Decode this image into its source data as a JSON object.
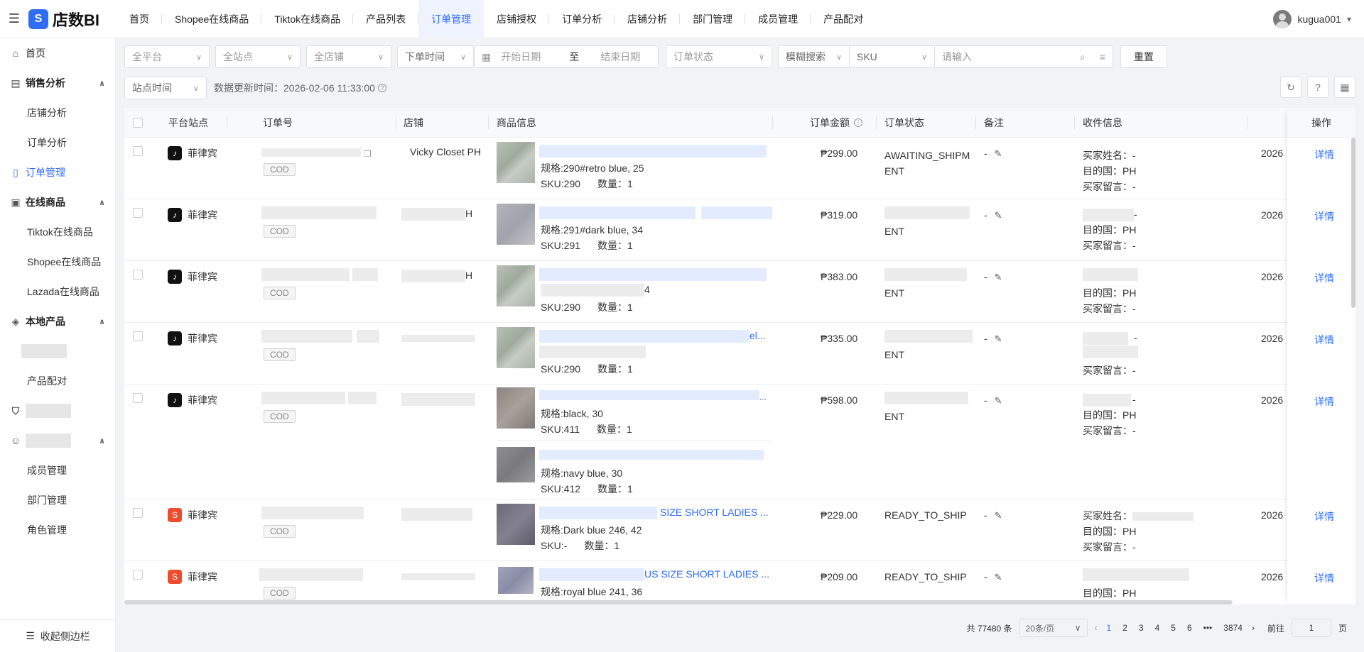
{
  "brand": {
    "name": "店数BI",
    "badge": "S"
  },
  "topnav": [
    "首页",
    "Shopee在线商品",
    "Tiktok在线商品",
    "产品列表",
    "订单管理",
    "店铺授权",
    "订单分析",
    "店铺分析",
    "部门管理",
    "成员管理",
    "产品配对"
  ],
  "topnav_active": "订单管理",
  "user": {
    "name": "kugua001"
  },
  "sidebar": {
    "home": "首页",
    "sales_group": "销售分析",
    "shop_analysis": "店铺分析",
    "order_analysis": "订单分析",
    "order_manage": "订单管理",
    "online_group": "在线商品",
    "tiktok_online": "Tiktok在线商品",
    "shopee_online": "Shopee在线商品",
    "lazada_online": "Lazada在线商品",
    "local_group": "本地产品",
    "product_match": "产品配对",
    "member_manage": "成员管理",
    "dept_manage": "部门管理",
    "role_manage": "角色管理",
    "collapse": "收起侧边栏"
  },
  "filters": {
    "platform": "全平台",
    "site": "全站点",
    "shop": "全店铺",
    "time_type": "下单时间",
    "start_date": "开始日期",
    "to": "至",
    "end_date": "结束日期",
    "order_status": "订单状态",
    "search_mode": "模糊搜索",
    "search_field": "SKU",
    "search_placeholder": "请输入",
    "reset": "重置",
    "site_time": "站点时间",
    "update_time": "数据更新时间：2026-02-06 11:33:00"
  },
  "columns": {
    "platform_site": "平台站点",
    "order_no": "订单号",
    "shop": "店铺",
    "product": "商品信息",
    "amount": "订单金额",
    "status": "订单状态",
    "remark": "备注",
    "receiver": "收件信息",
    "action": "操作"
  },
  "rows": [
    {
      "platform": "tiktok",
      "site": "菲律宾",
      "shop": "Vicky Closet PH",
      "cod": "COD",
      "spec": "规格:290#retro blue, 25",
      "sku": "SKU:290",
      "qty": "数量：1",
      "amount": "₱299.00",
      "status1": "AWAITING_SHIPM",
      "status2": "ENT",
      "remark": "-",
      "buyer": "买家姓名：-",
      "country": "目的国：PH",
      "msg": "买家留言：-",
      "date": "2026",
      "action": "详情"
    },
    {
      "platform": "tiktok",
      "site": "菲律宾",
      "shop_suffix": "H",
      "cod": "COD",
      "spec": "规格:291#dark blue, 34",
      "sku": "SKU:291",
      "qty": "数量：1",
      "amount": "₱319.00",
      "status2": "ENT",
      "remark": "-",
      "buyer_suffix": "-",
      "country": "目的国：PH",
      "msg": "买家留言：-",
      "date": "2026",
      "action": "详情"
    },
    {
      "platform": "tiktok",
      "site": "菲律宾",
      "shop_suffix": "H",
      "cod": "COD",
      "spec_suffix": "4",
      "sku": "SKU:290",
      "qty": "数量：1",
      "amount": "₱383.00",
      "status2": "ENT",
      "remark": "-",
      "country": "目的国：PH",
      "msg": "买家留言：-",
      "date": "2026",
      "action": "详情"
    },
    {
      "platform": "tiktok",
      "site": "菲律宾",
      "cod": "COD",
      "title_suffix": "el...",
      "sku": "SKU:290",
      "qty": "数量：1",
      "amount": "₱335.00",
      "status2": "ENT",
      "remark": "-",
      "buyer_suffix": "-",
      "msg": "买家留言：-",
      "date": "2026",
      "action": "详情"
    },
    {
      "platform": "tiktok",
      "site": "菲律宾",
      "cod": "COD",
      "spec": "规格:black, 30",
      "sku": "SKU:411",
      "qty": "数量：1",
      "spec_b": "规格:navy blue, 30",
      "sku_b": "SKU:412",
      "qty_b": "数量：1",
      "amount": "₱598.00",
      "status2": "ENT",
      "remark": "-",
      "buyer_suffix": "-",
      "country": "目的国：PH",
      "msg": "买家留言：-",
      "date": "2026",
      "action": "详情"
    },
    {
      "platform": "shopee",
      "site": "菲律宾",
      "cod": "COD",
      "title_suffix": "SIZE SHORT LADIES ...",
      "spec": "规格:Dark blue 246, 42",
      "sku": "SKU:-",
      "qty": "数量：1",
      "amount": "₱229.00",
      "status1": "READY_TO_SHIP",
      "remark": "-",
      "buyer": "买家姓名：",
      "country": "目的国：PH",
      "msg": "买家留言：-",
      "date": "2026",
      "action": "详情"
    },
    {
      "platform": "shopee",
      "site": "菲律宾",
      "cod": "COD",
      "title_suffix": "US SIZE SHORT LADIES ...",
      "spec": "规格:royal blue 241, 36",
      "amount": "₱209.00",
      "status1": "READY_TO_SHIP",
      "remark": "-",
      "country": "目的国：PH",
      "date": "2026",
      "action": "详情"
    }
  ],
  "pagination": {
    "total": "共 77480 条",
    "page_size": "20条/页",
    "pages": [
      "1",
      "2",
      "3",
      "4",
      "5",
      "6"
    ],
    "ellipsis": "•••",
    "last": "3874",
    "goto": "前往",
    "goto_value": "1",
    "page_unit": "页"
  }
}
